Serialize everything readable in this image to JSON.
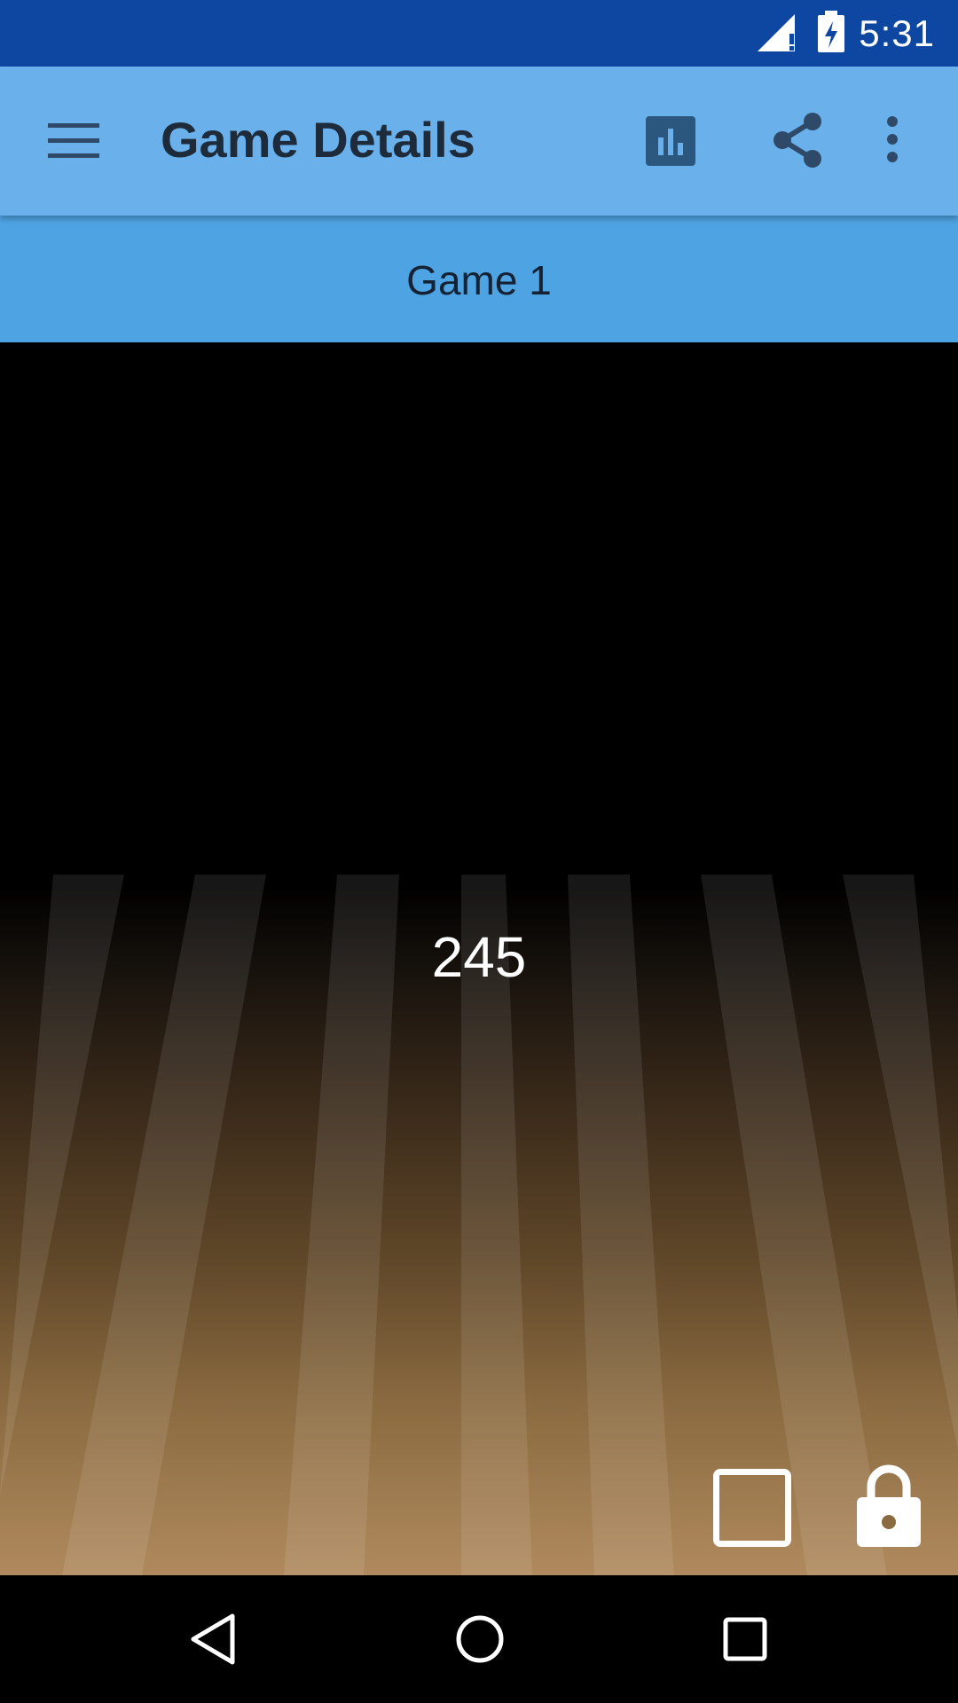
{
  "status_bar": {
    "time": "5:31",
    "icons": [
      "cell-signal-icon",
      "battery-charging-icon"
    ]
  },
  "app_bar": {
    "title": "Game Details",
    "icons": [
      "menu-icon",
      "bar-chart-icon",
      "share-icon",
      "more-vert-icon"
    ]
  },
  "sub_header": {
    "game_label": "Game 1"
  },
  "game": {
    "score": "245",
    "icons": [
      "checkbox-icon",
      "lock-icon"
    ]
  },
  "nav_bar": {
    "icons": [
      "back-icon",
      "home-icon",
      "recents-icon"
    ]
  },
  "colors": {
    "status_bar": "#0d47a1",
    "app_bar": "#6ab1ec",
    "sub_header": "#4ea3e2",
    "lane_light": "#b08a5e"
  }
}
